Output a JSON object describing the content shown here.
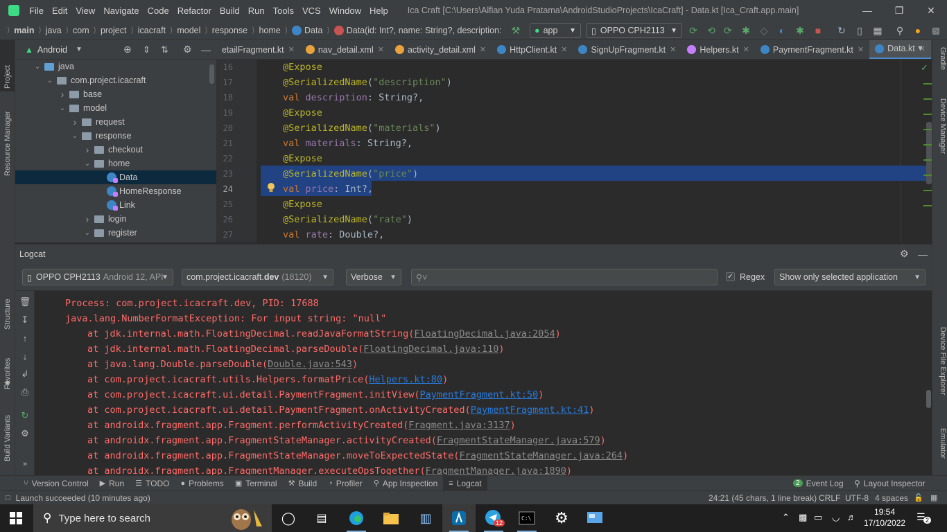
{
  "menubar": {
    "items": [
      "File",
      "Edit",
      "View",
      "Navigate",
      "Code",
      "Refactor",
      "Build",
      "Run",
      "Tools",
      "VCS",
      "Window",
      "Help"
    ],
    "title": "Ica Craft [C:\\Users\\Alfian Yuda Pratama\\AndroidStudioProjects\\IcaCraft] - Data.kt [Ica_Craft.app.main]"
  },
  "navbar": {
    "crumbs": [
      "main",
      "java",
      "com",
      "project",
      "icacraft",
      "model",
      "response",
      "home",
      "Data",
      "Data(id: Int?, name: String?, description: Stri..."
    ],
    "run_config": "app",
    "device": "OPPO CPH2113"
  },
  "left_tools": [
    "Project",
    "Resource Manager",
    "Structure",
    "Favorites",
    "Build Variants"
  ],
  "right_tools": [
    "Gradle",
    "Device Manager",
    "Device File Explorer",
    "Emulator"
  ],
  "project": {
    "view_label": "Android",
    "tree": [
      {
        "label": "java",
        "kind": "folder-blue",
        "depth": 1,
        "state": "expanded"
      },
      {
        "label": "com.project.icacraft",
        "kind": "folder",
        "depth": 2,
        "state": "expanded"
      },
      {
        "label": "base",
        "kind": "folder",
        "depth": 3,
        "state": "collapsed"
      },
      {
        "label": "model",
        "kind": "folder",
        "depth": 3,
        "state": "expanded"
      },
      {
        "label": "request",
        "kind": "folder",
        "depth": 4,
        "state": "collapsed"
      },
      {
        "label": "response",
        "kind": "folder",
        "depth": 4,
        "state": "expanded"
      },
      {
        "label": "checkout",
        "kind": "folder",
        "depth": 5,
        "state": "collapsed"
      },
      {
        "label": "home",
        "kind": "folder",
        "depth": 5,
        "state": "expanded"
      },
      {
        "label": "Data",
        "kind": "kotlin-class",
        "depth": 6,
        "state": "leaf",
        "selected": true
      },
      {
        "label": "HomeResponse",
        "kind": "kotlin-class",
        "depth": 6,
        "state": "leaf"
      },
      {
        "label": "Link",
        "kind": "kotlin-class",
        "depth": 6,
        "state": "leaf"
      },
      {
        "label": "login",
        "kind": "folder",
        "depth": 5,
        "state": "collapsed"
      },
      {
        "label": "register",
        "kind": "folder",
        "depth": 5,
        "state": "expanded"
      }
    ]
  },
  "editor": {
    "tabs": [
      {
        "label": "etailFragment.kt",
        "icon_color": ""
      },
      {
        "label": "nav_detail.xml",
        "icon_color": "#e8a33d"
      },
      {
        "label": "activity_detail.xml",
        "icon_color": "#e8a33d"
      },
      {
        "label": "HttpClient.kt",
        "icon_color": "#3d86c6"
      },
      {
        "label": "SignUpFragment.kt",
        "icon_color": "#3d86c6"
      },
      {
        "label": "Helpers.kt",
        "icon_color": "#c77dff"
      },
      {
        "label": "PaymentFragment.kt",
        "icon_color": "#3d86c6"
      },
      {
        "label": "Data.kt",
        "icon_color": "#3d86c6",
        "active": true
      }
    ],
    "current_line": "24",
    "lines": [
      {
        "no": "16",
        "parts": [
          {
            "t": "@Expose",
            "c": "ann"
          }
        ]
      },
      {
        "no": "17",
        "parts": [
          {
            "t": "@SerializedName",
            "c": "ann"
          },
          {
            "t": "(",
            "c": "typ"
          },
          {
            "t": "\"description\"",
            "c": "str"
          },
          {
            "t": ")",
            "c": "typ"
          }
        ]
      },
      {
        "no": "18",
        "parts": [
          {
            "t": "val ",
            "c": "kw"
          },
          {
            "t": "description",
            "c": "prop"
          },
          {
            "t": ": String?,",
            "c": "typ"
          }
        ]
      },
      {
        "no": "19",
        "parts": [
          {
            "t": "@Expose",
            "c": "ann"
          }
        ]
      },
      {
        "no": "20",
        "parts": [
          {
            "t": "@SerializedName",
            "c": "ann"
          },
          {
            "t": "(",
            "c": "typ"
          },
          {
            "t": "\"materials\"",
            "c": "str"
          },
          {
            "t": ")",
            "c": "typ"
          }
        ]
      },
      {
        "no": "21",
        "parts": [
          {
            "t": "val ",
            "c": "kw"
          },
          {
            "t": "materials",
            "c": "prop"
          },
          {
            "t": ": String?,",
            "c": "typ"
          }
        ]
      },
      {
        "no": "22",
        "parts": [
          {
            "t": "@Expose",
            "c": "ann"
          }
        ]
      },
      {
        "no": "23",
        "parts": [
          {
            "t": "@SerializedName",
            "c": "ann"
          },
          {
            "t": "(",
            "c": "typ"
          },
          {
            "t": "\"price\"",
            "c": "str"
          },
          {
            "t": ")",
            "c": "typ"
          }
        ]
      },
      {
        "no": "24",
        "parts": [
          {
            "t": "val ",
            "c": "kw"
          },
          {
            "t": "price",
            "c": "prop"
          },
          {
            "t": ": Int?,",
            "c": "typ"
          }
        ]
      },
      {
        "no": "25",
        "parts": [
          {
            "t": "@Expose",
            "c": "ann"
          }
        ]
      },
      {
        "no": "26",
        "parts": [
          {
            "t": "@SerializedName",
            "c": "ann"
          },
          {
            "t": "(",
            "c": "typ"
          },
          {
            "t": "\"rate\"",
            "c": "str"
          },
          {
            "t": ")",
            "c": "typ"
          }
        ]
      },
      {
        "no": "27",
        "parts": [
          {
            "t": "val ",
            "c": "kw"
          },
          {
            "t": "rate",
            "c": "prop"
          },
          {
            "t": ": Double?,",
            "c": "typ"
          }
        ]
      }
    ]
  },
  "logcat": {
    "title": "Logcat",
    "device_name": "OPPO CPH2113",
    "device_detail": "Android 12, API",
    "package_name": "com.project.icacraft.",
    "package_bold": "dev",
    "package_pid": "(18120)",
    "level": "Verbose",
    "search_placeholder": "",
    "regex_label": "Regex",
    "filter": "Show only selected application",
    "lines": [
      {
        "indent": 0,
        "text": "Process: com.project.icacraft.dev, PID: 17688",
        "link": "",
        "link_style": "",
        "after": ""
      },
      {
        "indent": 0,
        "text": "java.lang.NumberFormatException: For input string: \"null\"",
        "link": "",
        "link_style": "",
        "after": ""
      },
      {
        "indent": 1,
        "text": "at jdk.internal.math.FloatingDecimal.readJavaFormatString(",
        "link": "FloatingDecimal.java:2054",
        "link_style": "grey",
        "after": ")"
      },
      {
        "indent": 1,
        "text": "at jdk.internal.math.FloatingDecimal.parseDouble(",
        "link": "FloatingDecimal.java:110",
        "link_style": "grey",
        "after": ")"
      },
      {
        "indent": 1,
        "text": "at java.lang.Double.parseDouble(",
        "link": "Double.java:543",
        "link_style": "grey",
        "after": ")"
      },
      {
        "indent": 1,
        "text": "at com.project.icacraft.utils.Helpers.formatPrice(",
        "link": "Helpers.kt:80",
        "link_style": "blue",
        "after": ")"
      },
      {
        "indent": 1,
        "text": "at com.project.icacraft.ui.detail.PaymentFragment.initView(",
        "link": "PaymentFragment.kt:50",
        "link_style": "blue",
        "after": ")"
      },
      {
        "indent": 1,
        "text": "at com.project.icacraft.ui.detail.PaymentFragment.onActivityCreated(",
        "link": "PaymentFragment.kt:41",
        "link_style": "blue",
        "after": ")"
      },
      {
        "indent": 1,
        "text": "at androidx.fragment.app.Fragment.performActivityCreated(",
        "link": "Fragment.java:3137",
        "link_style": "grey",
        "after": ")"
      },
      {
        "indent": 1,
        "text": "at androidx.fragment.app.FragmentStateManager.activityCreated(",
        "link": "FragmentStateManager.java:579",
        "link_style": "grey",
        "after": ")"
      },
      {
        "indent": 1,
        "text": "at androidx.fragment.app.FragmentStateManager.moveToExpectedState(",
        "link": "FragmentStateManager.java:264",
        "link_style": "grey",
        "after": ")"
      },
      {
        "indent": 1,
        "text": "at androidx.fragment.app.FragmentManager.executeOpsTogether(",
        "link": "FragmentManager.java:1890",
        "link_style": "grey",
        "after": ")"
      }
    ]
  },
  "bottom_tabs": [
    {
      "label": "Version Control",
      "icon": "⑂"
    },
    {
      "label": "Run",
      "icon": "▶"
    },
    {
      "label": "TODO",
      "icon": "☰"
    },
    {
      "label": "Problems",
      "icon": "●"
    },
    {
      "label": "Terminal",
      "icon": "▣"
    },
    {
      "label": "Build",
      "icon": "⚒"
    },
    {
      "label": "Profiler",
      "icon": "◔"
    },
    {
      "label": "App Inspection",
      "icon": "⚲"
    },
    {
      "label": "Logcat",
      "icon": "≡",
      "active": true
    }
  ],
  "event_log": {
    "count": "2",
    "label": "Event Log"
  },
  "layout_inspector": "Layout Inspector",
  "status": {
    "message": "Launch succeeded (10 minutes ago)",
    "position": "24:21 (45 chars, 1 line break)",
    "line_sep": "CRLF",
    "encoding": "UTF-8",
    "indent": "4 spaces"
  },
  "taskbar": {
    "search_placeholder": "Type here to search",
    "time": "19:54",
    "date": "17/10/2022",
    "notifications": "2",
    "telegram_badge": "12"
  },
  "colors": {
    "accent": "#4a88c7",
    "error_text": "#ff6b68",
    "link": "#287bde",
    "selection": "#214283"
  }
}
